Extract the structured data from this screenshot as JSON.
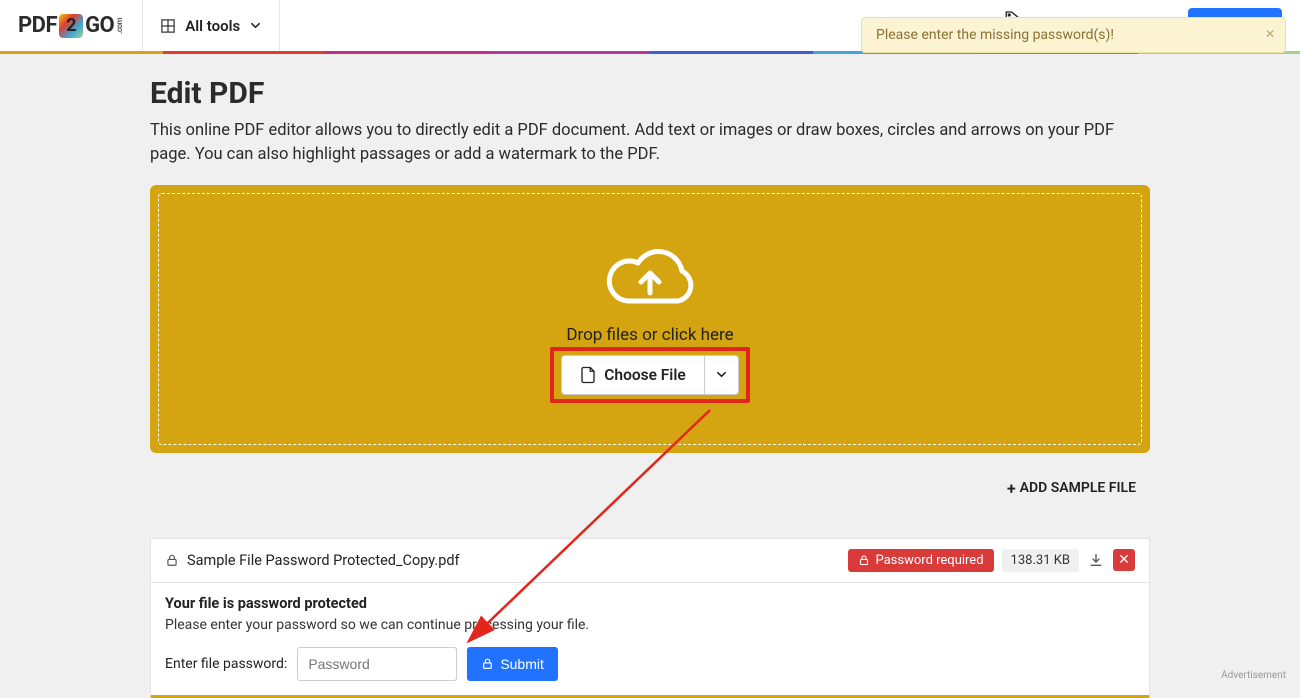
{
  "header": {
    "logo_pdf": "PDF",
    "logo_two": "2",
    "logo_go": "GO",
    "logo_com": ".com",
    "alltools": "All tools",
    "pricing": "Pricing"
  },
  "rainbow_colors": [
    "#d4a510",
    "#e03c31",
    "#c02e86",
    "#b13b9a",
    "#3f5ed6",
    "#3fa7d6",
    "#39b28a",
    "#a8d08d"
  ],
  "page": {
    "title": "Edit PDF",
    "subtitle": "This online PDF editor allows you to directly edit a PDF document. Add text or images or draw boxes, circles and arrows on your PDF page. You can also highlight passages or add a watermark to the PDF."
  },
  "dropzone": {
    "text": "Drop files or click here",
    "choose_label": "Choose File"
  },
  "add_sample": "ADD SAMPLE FILE",
  "file": {
    "name": "Sample File Password Protected_Copy.pdf",
    "pw_required": "Password required",
    "size": "138.31 KB",
    "body_title": "Your file is password protected",
    "body_sub": "Please enter your password so we can continue processing your file.",
    "pw_label": "Enter file password:",
    "pw_placeholder": "Password",
    "submit": "Submit"
  },
  "toast": {
    "msg": "Please enter the missing password(s)!"
  },
  "advert": "Advertisement"
}
